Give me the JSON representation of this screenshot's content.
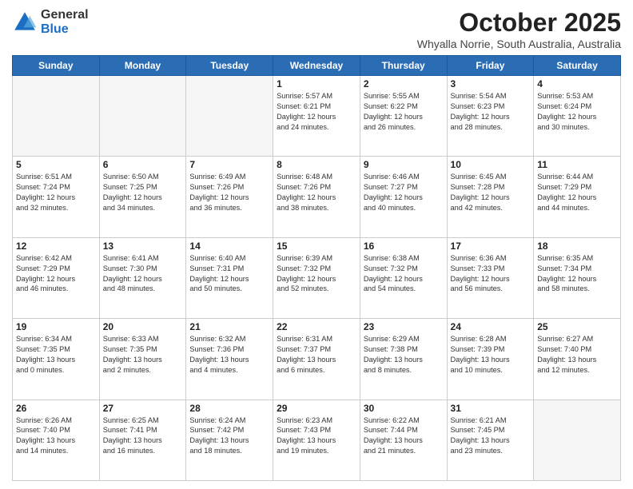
{
  "header": {
    "logo_general": "General",
    "logo_blue": "Blue",
    "month_title": "October 2025",
    "location": "Whyalla Norrie, South Australia, Australia"
  },
  "days_of_week": [
    "Sunday",
    "Monday",
    "Tuesday",
    "Wednesday",
    "Thursday",
    "Friday",
    "Saturday"
  ],
  "weeks": [
    [
      {
        "day": "",
        "info": ""
      },
      {
        "day": "",
        "info": ""
      },
      {
        "day": "",
        "info": ""
      },
      {
        "day": "1",
        "info": "Sunrise: 5:57 AM\nSunset: 6:21 PM\nDaylight: 12 hours\nand 24 minutes."
      },
      {
        "day": "2",
        "info": "Sunrise: 5:55 AM\nSunset: 6:22 PM\nDaylight: 12 hours\nand 26 minutes."
      },
      {
        "day": "3",
        "info": "Sunrise: 5:54 AM\nSunset: 6:23 PM\nDaylight: 12 hours\nand 28 minutes."
      },
      {
        "day": "4",
        "info": "Sunrise: 5:53 AM\nSunset: 6:24 PM\nDaylight: 12 hours\nand 30 minutes."
      }
    ],
    [
      {
        "day": "5",
        "info": "Sunrise: 6:51 AM\nSunset: 7:24 PM\nDaylight: 12 hours\nand 32 minutes."
      },
      {
        "day": "6",
        "info": "Sunrise: 6:50 AM\nSunset: 7:25 PM\nDaylight: 12 hours\nand 34 minutes."
      },
      {
        "day": "7",
        "info": "Sunrise: 6:49 AM\nSunset: 7:26 PM\nDaylight: 12 hours\nand 36 minutes."
      },
      {
        "day": "8",
        "info": "Sunrise: 6:48 AM\nSunset: 7:26 PM\nDaylight: 12 hours\nand 38 minutes."
      },
      {
        "day": "9",
        "info": "Sunrise: 6:46 AM\nSunset: 7:27 PM\nDaylight: 12 hours\nand 40 minutes."
      },
      {
        "day": "10",
        "info": "Sunrise: 6:45 AM\nSunset: 7:28 PM\nDaylight: 12 hours\nand 42 minutes."
      },
      {
        "day": "11",
        "info": "Sunrise: 6:44 AM\nSunset: 7:29 PM\nDaylight: 12 hours\nand 44 minutes."
      }
    ],
    [
      {
        "day": "12",
        "info": "Sunrise: 6:42 AM\nSunset: 7:29 PM\nDaylight: 12 hours\nand 46 minutes."
      },
      {
        "day": "13",
        "info": "Sunrise: 6:41 AM\nSunset: 7:30 PM\nDaylight: 12 hours\nand 48 minutes."
      },
      {
        "day": "14",
        "info": "Sunrise: 6:40 AM\nSunset: 7:31 PM\nDaylight: 12 hours\nand 50 minutes."
      },
      {
        "day": "15",
        "info": "Sunrise: 6:39 AM\nSunset: 7:32 PM\nDaylight: 12 hours\nand 52 minutes."
      },
      {
        "day": "16",
        "info": "Sunrise: 6:38 AM\nSunset: 7:32 PM\nDaylight: 12 hours\nand 54 minutes."
      },
      {
        "day": "17",
        "info": "Sunrise: 6:36 AM\nSunset: 7:33 PM\nDaylight: 12 hours\nand 56 minutes."
      },
      {
        "day": "18",
        "info": "Sunrise: 6:35 AM\nSunset: 7:34 PM\nDaylight: 12 hours\nand 58 minutes."
      }
    ],
    [
      {
        "day": "19",
        "info": "Sunrise: 6:34 AM\nSunset: 7:35 PM\nDaylight: 13 hours\nand 0 minutes."
      },
      {
        "day": "20",
        "info": "Sunrise: 6:33 AM\nSunset: 7:35 PM\nDaylight: 13 hours\nand 2 minutes."
      },
      {
        "day": "21",
        "info": "Sunrise: 6:32 AM\nSunset: 7:36 PM\nDaylight: 13 hours\nand 4 minutes."
      },
      {
        "day": "22",
        "info": "Sunrise: 6:31 AM\nSunset: 7:37 PM\nDaylight: 13 hours\nand 6 minutes."
      },
      {
        "day": "23",
        "info": "Sunrise: 6:29 AM\nSunset: 7:38 PM\nDaylight: 13 hours\nand 8 minutes."
      },
      {
        "day": "24",
        "info": "Sunrise: 6:28 AM\nSunset: 7:39 PM\nDaylight: 13 hours\nand 10 minutes."
      },
      {
        "day": "25",
        "info": "Sunrise: 6:27 AM\nSunset: 7:40 PM\nDaylight: 13 hours\nand 12 minutes."
      }
    ],
    [
      {
        "day": "26",
        "info": "Sunrise: 6:26 AM\nSunset: 7:40 PM\nDaylight: 13 hours\nand 14 minutes."
      },
      {
        "day": "27",
        "info": "Sunrise: 6:25 AM\nSunset: 7:41 PM\nDaylight: 13 hours\nand 16 minutes."
      },
      {
        "day": "28",
        "info": "Sunrise: 6:24 AM\nSunset: 7:42 PM\nDaylight: 13 hours\nand 18 minutes."
      },
      {
        "day": "29",
        "info": "Sunrise: 6:23 AM\nSunset: 7:43 PM\nDaylight: 13 hours\nand 19 minutes."
      },
      {
        "day": "30",
        "info": "Sunrise: 6:22 AM\nSunset: 7:44 PM\nDaylight: 13 hours\nand 21 minutes."
      },
      {
        "day": "31",
        "info": "Sunrise: 6:21 AM\nSunset: 7:45 PM\nDaylight: 13 hours\nand 23 minutes."
      },
      {
        "day": "",
        "info": ""
      }
    ]
  ]
}
